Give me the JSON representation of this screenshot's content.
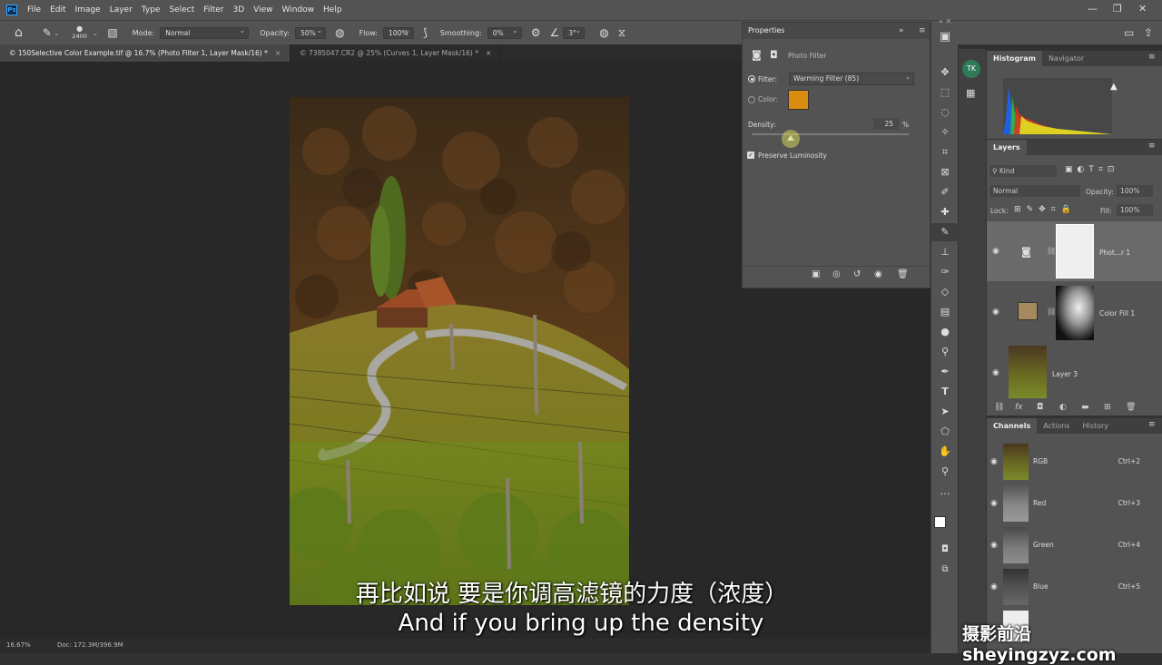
{
  "menu": [
    "File",
    "Edit",
    "Image",
    "Layer",
    "Type",
    "Select",
    "Filter",
    "3D",
    "View",
    "Window",
    "Help"
  ],
  "app_badge": "Ps",
  "options": {
    "brush_size": "2400",
    "mode_label": "Mode:",
    "mode_value": "Normal",
    "opacity_label": "Opacity:",
    "opacity_value": "50%",
    "flow_label": "Flow:",
    "flow_value": "100%",
    "smoothing_label": "Smoothing:",
    "smoothing_value": "0%",
    "angle_value": "3°"
  },
  "tabs": [
    {
      "label": "© 150Selective Color Example.tif @ 16.7% (Photo Filter 1, Layer Mask/16) *",
      "close": "×"
    },
    {
      "label": "© 7385047.CR2 @ 25% (Curves 1, Layer Mask/16) *",
      "close": "×"
    }
  ],
  "status": {
    "zoom": "16.67%",
    "doc": "Doc: 172.3M/396.9M"
  },
  "properties": {
    "title": "Properties",
    "subtitle": "Photo Filter",
    "filter_label": "Filter:",
    "filter_value": "Warming Filter (85)",
    "color_label": "Color:",
    "color_swatch": "#d98c10",
    "density_label": "Density:",
    "density_value": "25",
    "density_unit": "%",
    "density_level": 0.25,
    "preserve_label": "Preserve Luminosity",
    "preserve_checked": true
  },
  "histogram": {
    "tabs": [
      "Histogram",
      "Navigator"
    ],
    "warning": "▲"
  },
  "layers": {
    "title": "Layers",
    "kind_label": "Kind",
    "blend_value": "Normal",
    "opacity_label": "Opacity:",
    "opacity_value": "100%",
    "lock_label": "Lock:",
    "fill_label": "Fill:",
    "fill_value": "100%",
    "rows": [
      {
        "name": "Phot...r 1"
      },
      {
        "name": "Color Fill 1"
      },
      {
        "name": "Layer 3"
      }
    ],
    "footer": [
      "fx"
    ]
  },
  "channels": {
    "tabs": [
      "Channels",
      "Actions",
      "History"
    ],
    "rows": [
      {
        "name": "RGB",
        "shortcut": "Ctrl+2"
      },
      {
        "name": "Red",
        "shortcut": "Ctrl+3"
      },
      {
        "name": "Green",
        "shortcut": "Ctrl+4"
      },
      {
        "name": "Blue",
        "shortcut": "Ctrl+5"
      }
    ]
  },
  "subtitles": {
    "zh": "再比如说 要是你调高滤镜的力度（浓度）",
    "en": "And if you bring up the density"
  },
  "watermark": "摄影前沿 sheyingzyz.com"
}
